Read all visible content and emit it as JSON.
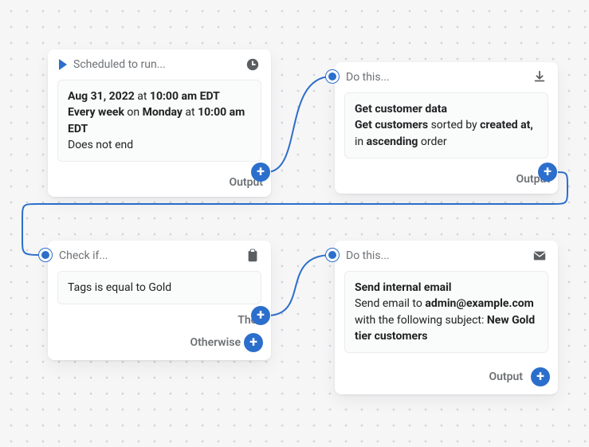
{
  "nodes": {
    "schedule": {
      "header": "Scheduled to run...",
      "date": "Aug 31, 2022",
      "at1": " at ",
      "time1": "10:00 am EDT",
      "every": "Every week",
      "on": " on ",
      "day": "Monday",
      "at2": " at ",
      "time2": "10:00 am EDT",
      "end": "Does not end",
      "output": "Output"
    },
    "getdata": {
      "header": "Do this...",
      "title": "Get customer data",
      "l1a": "Get customers",
      "l1b": " sorted by ",
      "l1c": "created at,",
      "l1d": " in ",
      "l1e": "ascending",
      "l1f": " order",
      "output": "Output"
    },
    "check": {
      "header": "Check if...",
      "cond": "Tags is equal to Gold",
      "then": "Then",
      "otherwise": "Otherwise"
    },
    "email": {
      "header": "Do this...",
      "title": "Send internal email",
      "l1": "Send email to ",
      "addr": "admin@example.com",
      "l2": " with the following subject: ",
      "subj": "New Gold tier customers",
      "output": "Output"
    }
  }
}
